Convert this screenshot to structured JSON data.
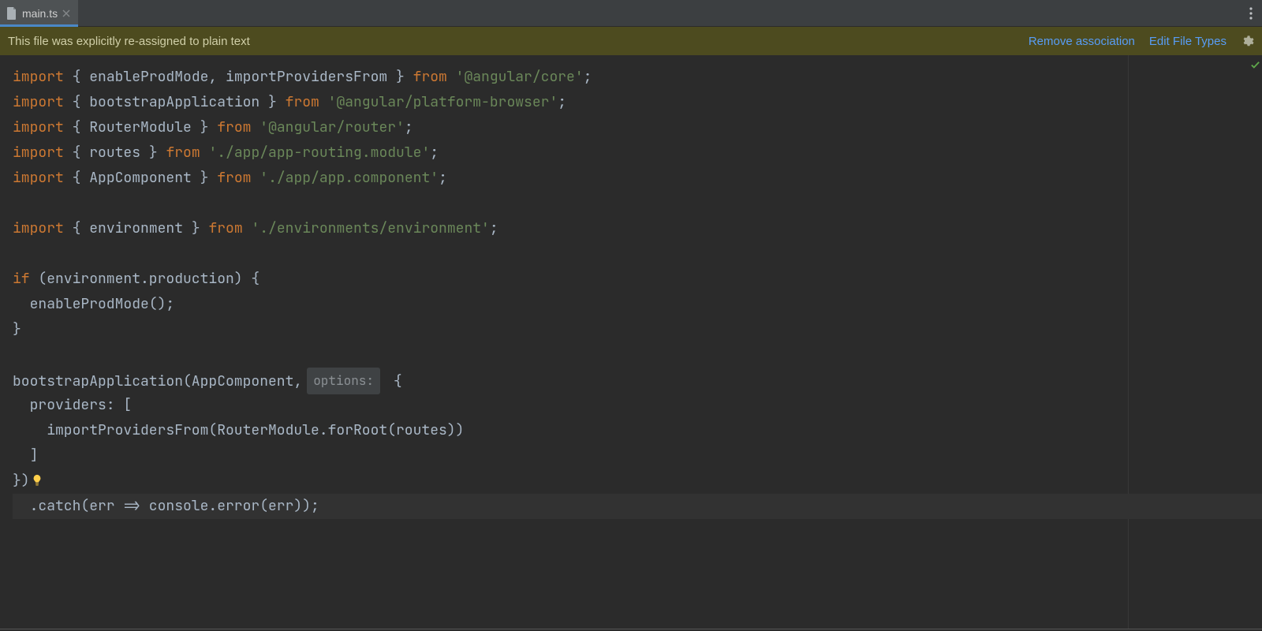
{
  "tabbar": {
    "tab_filename": "main.ts",
    "tab_active": true
  },
  "banner": {
    "message": "This file was explicitly re-assigned to plain text",
    "actions": {
      "remove_label": "Remove association",
      "edit_label": "Edit File Types"
    }
  },
  "editor": {
    "hint_label": "options:",
    "right_margin_col": 120,
    "inspection_ok": true,
    "code": {
      "l1": {
        "a": "import",
        "b": "{ enableProdMode, importProvidersFrom }",
        "c": "from",
        "d": "'@angular/core'",
        "e": ";"
      },
      "l2": {
        "a": "import",
        "b": "{ bootstrapApplication }",
        "c": "from",
        "d": "'@angular/platform-browser'",
        "e": ";"
      },
      "l3": {
        "a": "import",
        "b": "{ RouterModule }",
        "c": "from",
        "d": "'@angular/router'",
        "e": ";"
      },
      "l4": {
        "a": "import",
        "b": "{ routes }",
        "c": "from",
        "d": "'./app/app-routing.module'",
        "e": ";"
      },
      "l5": {
        "a": "import",
        "b": "{ AppComponent }",
        "c": "from",
        "d": "'./app/app.component'",
        "e": ";"
      },
      "l6": "",
      "l7": {
        "a": "import",
        "b": "{ environment }",
        "c": "from",
        "d": "'./environments/environment'",
        "e": ";"
      },
      "l8": "",
      "l9": {
        "a": "if",
        "b": " (environment.production) {"
      },
      "l10": "  enableProdMode();",
      "l11": "}",
      "l12": "",
      "l13": {
        "a": "bootstrapApplication(AppComponent,",
        "chip": "options:",
        "b": " {"
      },
      "l14": "  providers: [",
      "l15": "    importProvidersFrom(RouterModule.forRoot(routes))",
      "l16": "  ]",
      "l17": "})",
      "l18": "  .catch(err => console.error(err));"
    }
  }
}
